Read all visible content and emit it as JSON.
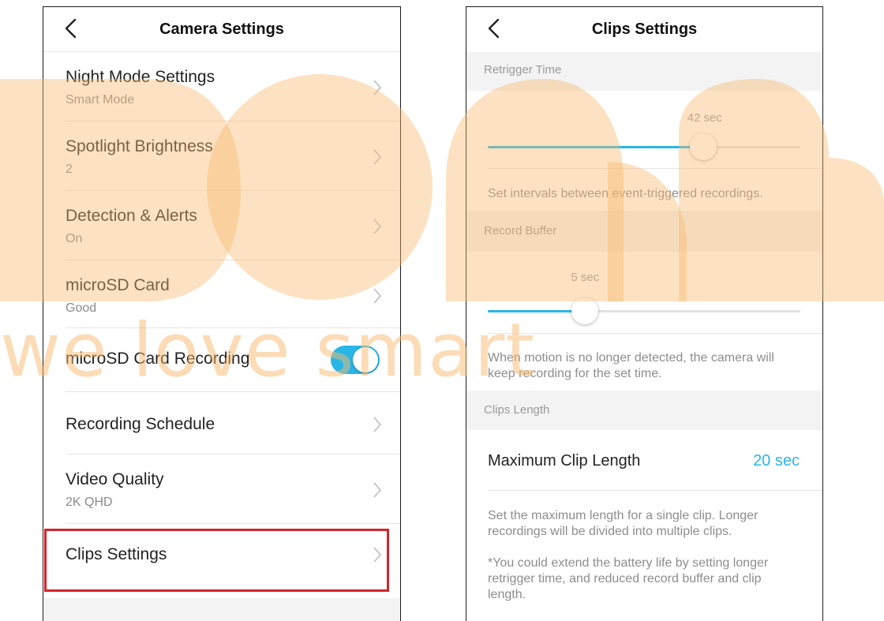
{
  "left": {
    "title": "Camera Settings",
    "rows": [
      {
        "label": "Night Mode Settings",
        "sub": "Smart Mode"
      },
      {
        "label": "Spotlight Brightness",
        "sub": "2"
      },
      {
        "label": "Detection & Alerts",
        "sub": "On"
      },
      {
        "label": "microSD Card",
        "sub": "Good"
      },
      {
        "label": "microSD Card Recording",
        "toggle_on": true
      },
      {
        "label": "Recording Schedule"
      },
      {
        "label": "Video Quality",
        "sub": "2K QHD"
      },
      {
        "label": "Clips Settings"
      }
    ]
  },
  "right": {
    "title": "Clips Settings",
    "retrigger": {
      "header": "Retrigger Time",
      "value_label": "42 sec",
      "fraction": 0.69,
      "description": "Set intervals between event-triggered recordings."
    },
    "buffer": {
      "header": "Record Buffer",
      "value_label": "5 sec",
      "fraction": 0.31,
      "description": "When motion is no longer detected, the camera will keep recording for the set time."
    },
    "clips": {
      "header": "Clips Length",
      "max_label": "Maximum Clip Length",
      "max_value": "20 sec",
      "description1": "Set the maximum length for a single clip. Longer recordings will be divided into multiple clips.",
      "description2": "*You could extend the battery life by setting longer retrigger time, and reduced record buffer and clip length."
    }
  },
  "watermark": {
    "text": "we love smart"
  },
  "colors": {
    "accent": "#29b6e6",
    "highlight": "#d4232b",
    "watermark": "#f7ba6e"
  },
  "icons": {
    "back": "chevron-left-icon",
    "row": "chevron-right-icon"
  }
}
